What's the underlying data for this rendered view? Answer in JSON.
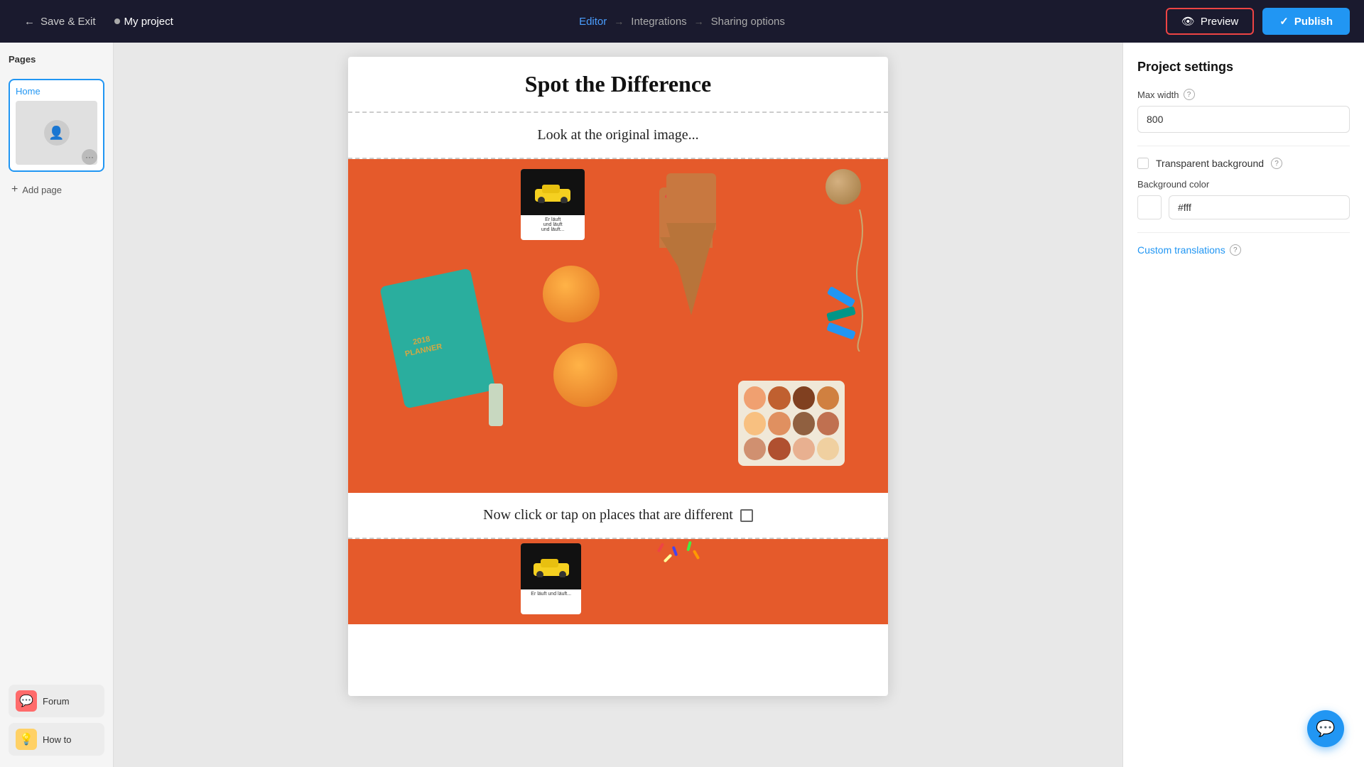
{
  "nav": {
    "save_exit": "Save & Exit",
    "project_name": "My project",
    "steps": [
      {
        "label": "Editor",
        "active": true
      },
      {
        "label": "Integrations",
        "active": false
      },
      {
        "label": "Sharing options",
        "active": false
      }
    ],
    "preview_label": "Preview",
    "publish_label": "Publish"
  },
  "pages_panel": {
    "title": "Pages",
    "home_page": "Home",
    "add_page_label": "Add page"
  },
  "tools": [
    {
      "name": "forum",
      "label": "Forum",
      "icon": "💬"
    },
    {
      "name": "howto",
      "label": "How to",
      "icon": "💡"
    }
  ],
  "canvas": {
    "title": "Spot the Difference",
    "subtitle": "Look at the original image...",
    "cta": "Now click or tap on places that are different"
  },
  "right_panel": {
    "title": "Project settings",
    "max_width_label": "Max width",
    "max_width_value": "800",
    "max_width_info": "?",
    "transparent_bg_label": "Transparent background",
    "transparent_bg_info": "?",
    "bg_color_label": "Background color",
    "bg_color_value": "#fff",
    "custom_translations_label": "Custom translations",
    "custom_translations_info": "?"
  },
  "colors": {
    "active_nav": "#4a9eff",
    "publish_bg": "#2196f3",
    "preview_border": "#e44444",
    "accent_blue": "#2196f3"
  },
  "makeup_colors": [
    "#f0a070",
    "#c06030",
    "#804020",
    "#d08040",
    "#f8c080",
    "#e09060",
    "#906040",
    "#c07050",
    "#d09070",
    "#b05030",
    "#e8b090",
    "#f0d0a0"
  ]
}
